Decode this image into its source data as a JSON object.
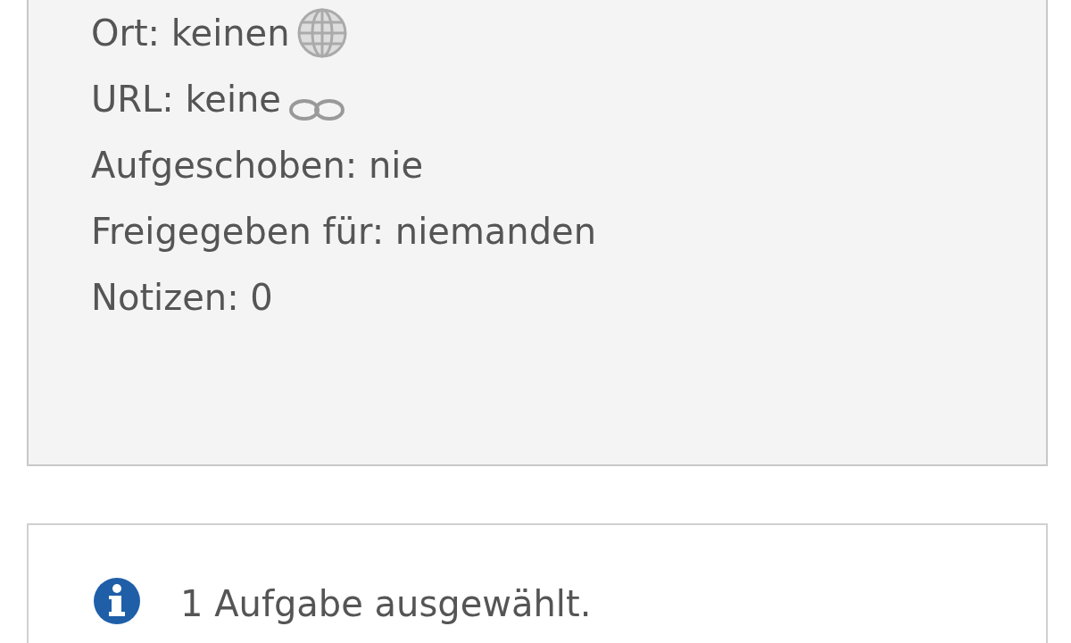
{
  "details": [
    {
      "text": "Ort: keinen",
      "kind": "globe"
    },
    {
      "text": "URL: keine",
      "kind": "link"
    },
    {
      "text": "Aufgeschoben: nie",
      "kind": "plain"
    },
    {
      "text": "Freigegeben für: niemanden",
      "kind": "plain"
    },
    {
      "text": "Notizen: 0",
      "kind": "plain"
    }
  ],
  "status": {
    "text": "1 Aufgabe ausgewählt."
  }
}
